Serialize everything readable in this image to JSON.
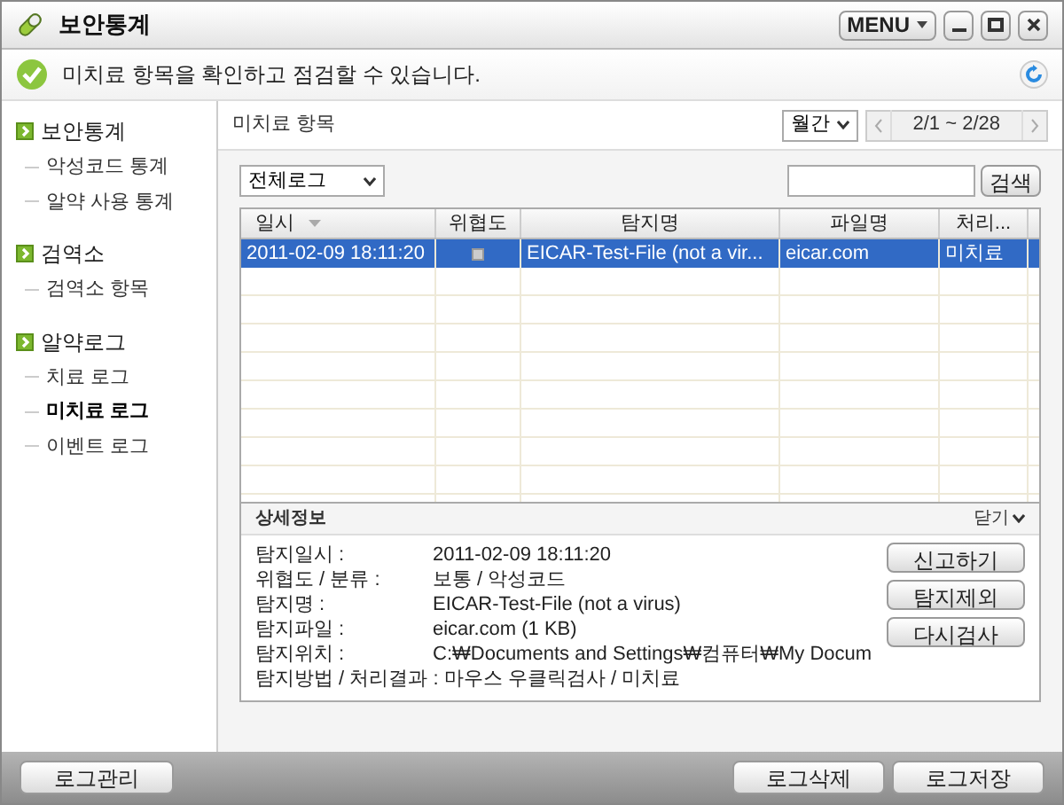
{
  "window": {
    "title": "보안통계",
    "menu_button": "MENU"
  },
  "message": "미치료 항목을 확인하고 점검할 수 있습니다.",
  "sidebar": {
    "groups": [
      {
        "label": "보안통계",
        "children": [
          {
            "label": "악성코드 통계",
            "selected": false
          },
          {
            "label": "알약 사용 통계",
            "selected": false
          }
        ]
      },
      {
        "label": "검역소",
        "children": [
          {
            "label": "검역소 항목",
            "selected": false
          }
        ]
      },
      {
        "label": "알약로그",
        "children": [
          {
            "label": "치료 로그",
            "selected": false
          },
          {
            "label": "미치료 로그",
            "selected": true
          },
          {
            "label": "이벤트 로그",
            "selected": false
          }
        ]
      }
    ]
  },
  "content": {
    "title": "미치료 항목",
    "period": "월간",
    "date_range": "2/1 ~ 2/28",
    "filter": "전체로그",
    "search_button": "검색"
  },
  "table": {
    "columns": [
      "일시",
      "위협도",
      "탐지명",
      "파일명",
      "처리..."
    ],
    "rows": [
      {
        "selected": true,
        "cells": [
          "2011-02-09 18:11:20",
          "",
          "EICAR-Test-File (not a vir...",
          "eicar.com",
          "미치료"
        ]
      }
    ]
  },
  "details": {
    "title": "상세정보",
    "close": "닫기",
    "fields": [
      {
        "label": "탐지일시 :",
        "value": "2011-02-09 18:11:20"
      },
      {
        "label": "위협도 / 분류 :",
        "value": "보통 / 악성코드"
      },
      {
        "label": "탐지명 :",
        "value": "EICAR-Test-File (not a virus)"
      },
      {
        "label": "탐지파일 :",
        "value": "eicar.com (1 KB)"
      },
      {
        "label": "탐지위치 :",
        "value": "C:₩Documents and Settings₩컴퓨터₩My Docum"
      }
    ],
    "method_line": "탐지방법 / 처리결과 : 마우스 우클릭검사 / 미치료",
    "buttons": [
      "신고하기",
      "탐지제외",
      "다시검사"
    ]
  },
  "footer": {
    "left_button": "로그관리",
    "right_buttons": [
      "로그삭제",
      "로그저장"
    ]
  }
}
